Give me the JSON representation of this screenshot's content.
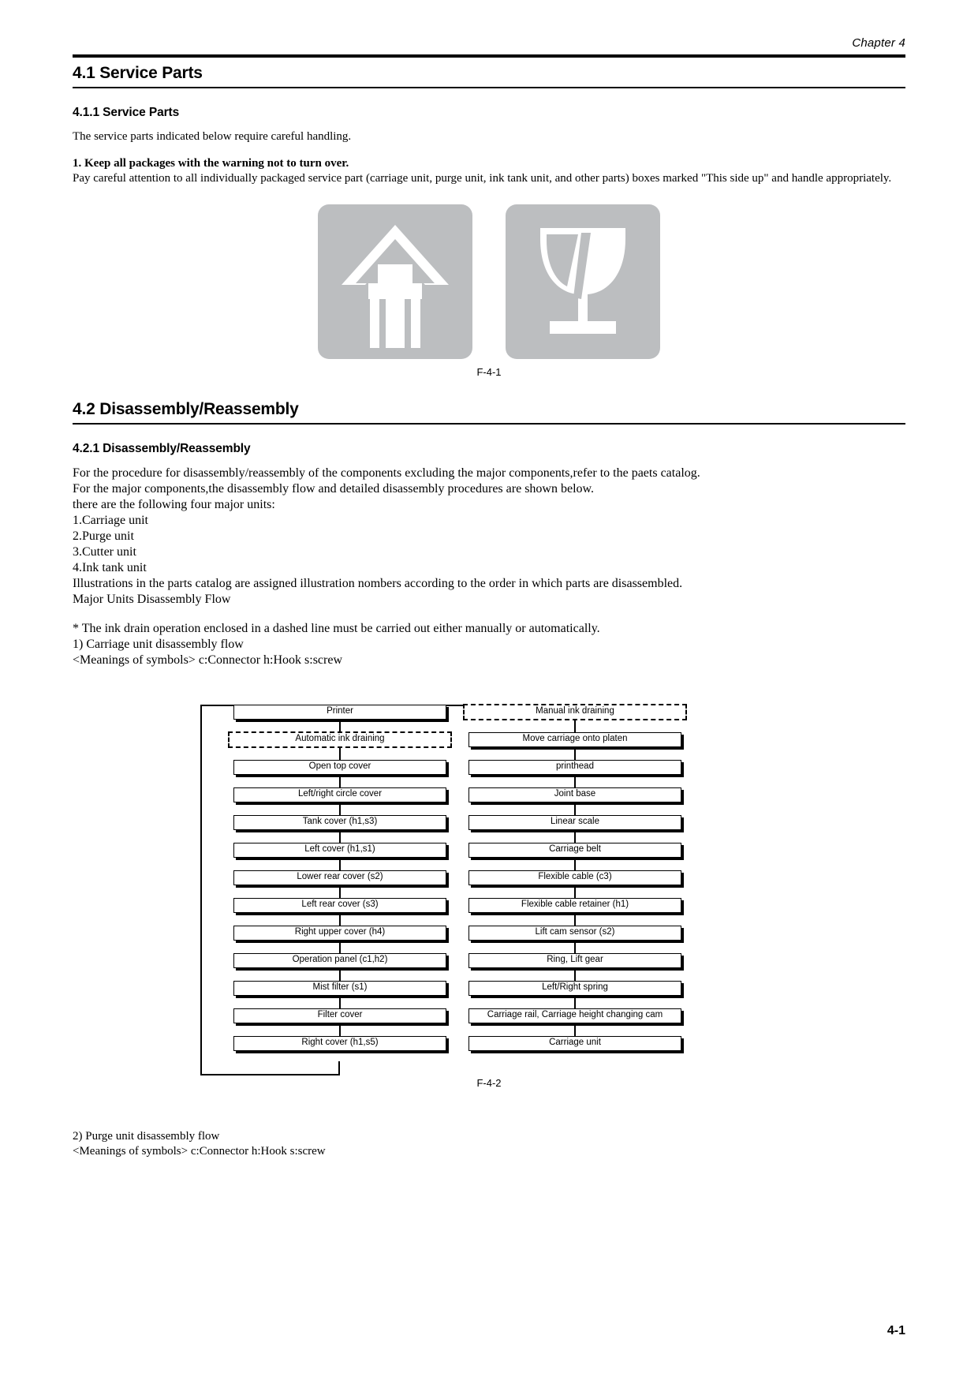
{
  "header": {
    "running_head": "Chapter 4"
  },
  "section_41": {
    "title": "4.1 Service Parts",
    "subtitle": "4.1.1 Service Parts",
    "intro": "The service parts indicated below require careful handling.",
    "warning_heading": "1. Keep all packages with the warning not to turn over.",
    "warning_body": "Pay careful attention to all individually packaged service part (carriage unit, purge unit, ink tank unit, and other parts) boxes marked \"This side up\" and handle appropriately.",
    "figure": {
      "caption": "F-4-1",
      "symbols": [
        {
          "name": "this-side-up-arrow",
          "alt": "This side up arrow"
        },
        {
          "name": "fragile-glass",
          "alt": "Fragile glass"
        }
      ],
      "fill_color": "#bcbec0"
    }
  },
  "section_42": {
    "title": "4.2 Disassembly/Reassembly",
    "subtitle": "4.2.1 Disassembly/Reassembly",
    "lines": [
      "For the procedure for disassembly/reassembly of the components excluding the major components,refer to the paets catalog.",
      "For the major components,the disassembly flow and detailed disassembly procedures are shown below.",
      "there are the following four major units:",
      "1.Carriage unit",
      "2.Purge unit",
      "3.Cutter unit",
      "4.Ink tank unit",
      "Illustrations in the parts catalog are assigned illustration nombers according to the order in which parts are disassembled.",
      "Major Units Disassembly Flow"
    ],
    "note_lines": [
      "* The ink drain operation enclosed in a dashed line must be carried out either manually or automatically.",
      "1) Carriage unit disassembly flow",
      "<Meanings of symbols>  c:Connector  h:Hook  s:screw"
    ],
    "flow": {
      "caption": "F-4-2",
      "left_column": [
        {
          "label": "Printer",
          "style": "solid"
        },
        {
          "label": "Automatic ink draining",
          "style": "dashed"
        },
        {
          "label": "Open top cover",
          "style": "solid"
        },
        {
          "label": "Left/right circle cover",
          "style": "solid"
        },
        {
          "label": "Tank cover (h1,s3)",
          "style": "solid"
        },
        {
          "label": "Left cover  (h1,s1)",
          "style": "solid"
        },
        {
          "label": "Lower rear cover  (s2)",
          "style": "solid"
        },
        {
          "label": "Left rear cover  (s3)",
          "style": "solid"
        },
        {
          "label": "Right upper cover  (h4)",
          "style": "solid"
        },
        {
          "label": "Operation panel  (c1,h2)",
          "style": "solid"
        },
        {
          "label": "Mist filter  (s1)",
          "style": "solid"
        },
        {
          "label": "Filter cover",
          "style": "solid"
        },
        {
          "label": "Right cover (h1,s5)",
          "style": "solid"
        }
      ],
      "right_column": [
        {
          "label": "Manual ink draining",
          "style": "dashed"
        },
        {
          "label": "Move carriage onto platen",
          "style": "solid"
        },
        {
          "label": "printhead",
          "style": "solid"
        },
        {
          "label": "Joint base",
          "style": "solid"
        },
        {
          "label": "Linear scale",
          "style": "solid"
        },
        {
          "label": "Carriage belt",
          "style": "solid"
        },
        {
          "label": "Flexible cable (c3)",
          "style": "solid"
        },
        {
          "label": "Flexible cable retainer  (h1)",
          "style": "solid"
        },
        {
          "label": "Lift cam sensor  (s2)",
          "style": "solid"
        },
        {
          "label": "Ring, Lift gear",
          "style": "solid"
        },
        {
          "label": "Left/Right spring",
          "style": "solid"
        },
        {
          "label": "Carriage rail, Carriage height changing cam",
          "style": "solid"
        },
        {
          "label": "Carriage unit",
          "style": "solid"
        }
      ]
    },
    "tail_lines": [
      "2) Purge unit disassembly flow",
      "<Meanings of symbols>  c:Connector  h:Hook  s:screw"
    ]
  },
  "footer": {
    "page_number": "4-1"
  }
}
